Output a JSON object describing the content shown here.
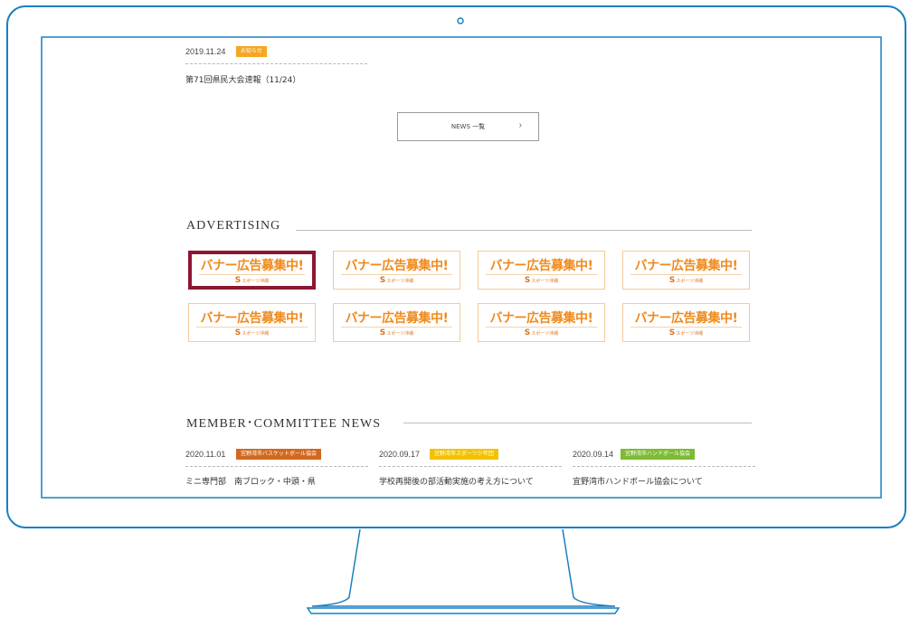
{
  "colors": {
    "frame": "#1a7fc0",
    "tag_notice": "#f5a623",
    "tag_basketball": "#d2691e",
    "tag_sports_youth": "#f2c200",
    "tag_handball": "#7dbb34",
    "banner_text": "#f08a1c",
    "banner_selected_border": "#8c1733"
  },
  "news_top": {
    "date": "2019.11.24",
    "tag": "お知らせ",
    "title": "第71回県民大会速報（11/24）"
  },
  "news_button": {
    "label": "NEWS 一覧",
    "chevron": "›"
  },
  "advertising": {
    "heading": "ADVERTISING",
    "banners": [
      {
        "text": "バナー広告募集中!",
        "logo": "スポーツ沖縄",
        "selected": true
      },
      {
        "text": "バナー広告募集中!",
        "logo": "スポーツ沖縄",
        "selected": false
      },
      {
        "text": "バナー広告募集中!",
        "logo": "スポーツ沖縄",
        "selected": false
      },
      {
        "text": "バナー広告募集中!",
        "logo": "スポーツ沖縄",
        "selected": false
      },
      {
        "text": "バナー広告募集中!",
        "logo": "スポーツ沖縄",
        "selected": false
      },
      {
        "text": "バナー広告募集中!",
        "logo": "スポーツ沖縄",
        "selected": false
      },
      {
        "text": "バナー広告募集中!",
        "logo": "スポーツ沖縄",
        "selected": false
      },
      {
        "text": "バナー広告募集中!",
        "logo": "スポーツ沖縄",
        "selected": false
      }
    ]
  },
  "member_news": {
    "heading": "MEMBER･COMMITTEE NEWS",
    "items": [
      {
        "date": "2020.11.01",
        "tag": "宜野湾市バスケットボール協会",
        "title": "ミニ専門部　南ブロック・中頭・県"
      },
      {
        "date": "2020.09.17",
        "tag": "宜野湾市スポーツ少年団",
        "title": "学校再開後の部活動実施の考え方について"
      },
      {
        "date": "2020.09.14",
        "tag": "宜野湾市ハンドボール協会",
        "title": "宜野湾市ハンドボール協会について"
      }
    ]
  }
}
